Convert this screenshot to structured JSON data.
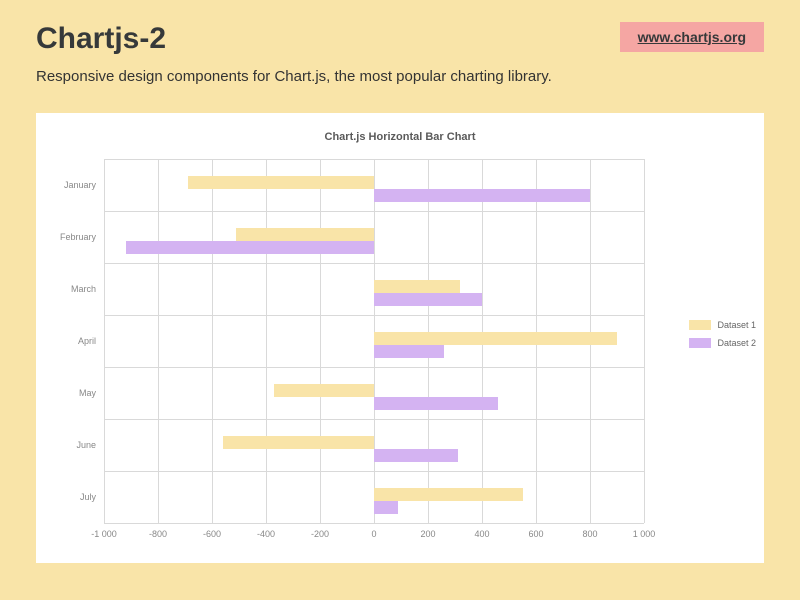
{
  "header": {
    "title": "Chartjs-2",
    "link_text": "www.chartjs.org"
  },
  "subtitle": "Responsive design components for Chart.js, the most popular charting library.",
  "chart_data": {
    "type": "bar",
    "orientation": "horizontal",
    "title": "Chart.js Horizontal Bar Chart",
    "xlabel": "",
    "ylabel": "",
    "xlim": [
      -1000,
      1000
    ],
    "x_ticks": [
      -1000,
      -800,
      -600,
      -400,
      -200,
      0,
      200,
      400,
      600,
      800,
      1000
    ],
    "x_tick_labels": [
      "-1 000",
      "-800",
      "-600",
      "-400",
      "-200",
      "0",
      "200",
      "400",
      "600",
      "800",
      "1 000"
    ],
    "categories": [
      "January",
      "February",
      "March",
      "April",
      "May",
      "June",
      "July"
    ],
    "series": [
      {
        "name": "Dataset 1",
        "color": "#f9e4a8",
        "values": [
          -690,
          -510,
          320,
          900,
          -370,
          -560,
          550
        ]
      },
      {
        "name": "Dataset 2",
        "color": "#d4b3f2",
        "values": [
          800,
          -920,
          400,
          260,
          460,
          310,
          90
        ]
      }
    ],
    "legend_position": "right",
    "grid": true
  }
}
